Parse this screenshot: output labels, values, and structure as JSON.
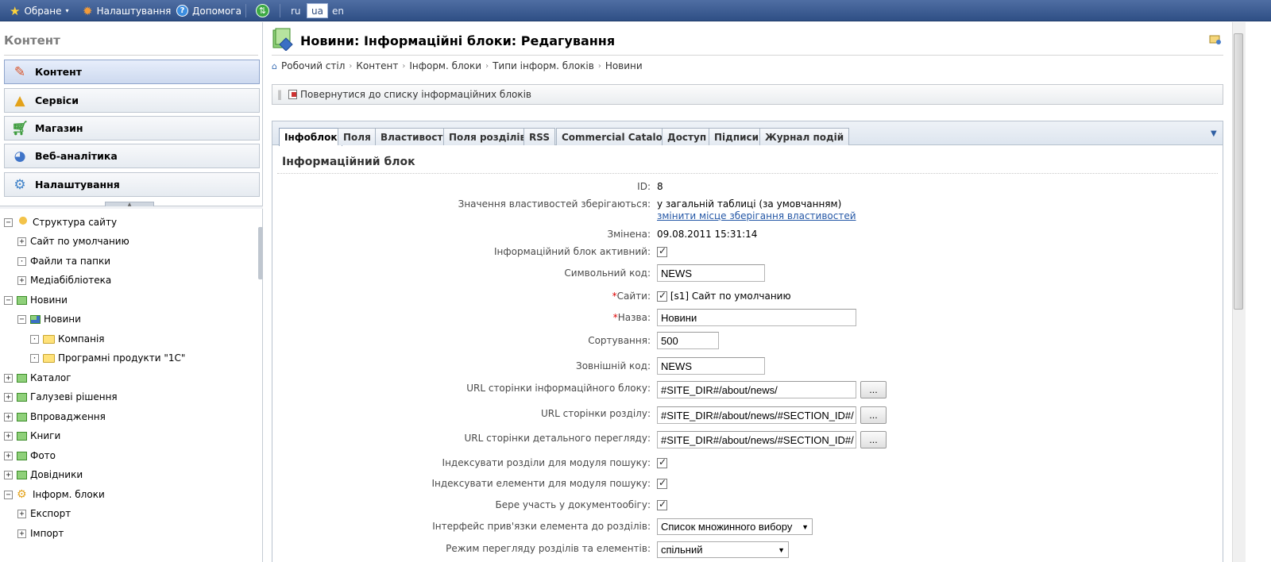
{
  "topbar": {
    "favorites": "Обране",
    "settings": "Налаштування",
    "help": "Допомога",
    "languages": [
      "ru",
      "ua",
      "en"
    ],
    "active_language": "ua"
  },
  "sidebar": {
    "title": "Контент",
    "menu": [
      {
        "label": "Контент",
        "icon": "pencil-icon",
        "active": true
      },
      {
        "label": "Сервіси",
        "icon": "shapes-icon",
        "active": false
      },
      {
        "label": "Магазин",
        "icon": "cart-icon",
        "active": false
      },
      {
        "label": "Веб-аналітика",
        "icon": "analytics-icon",
        "active": false
      },
      {
        "label": "Налаштування",
        "icon": "gear-icon",
        "active": false
      }
    ],
    "tree": [
      {
        "label": "Структура сайту",
        "toggle": "−"
      },
      {
        "label": "Сайт по умолчанию",
        "toggle": "+"
      },
      {
        "label": "Файли та папки",
        "toggle": "·"
      },
      {
        "label": "Медіабібліотека",
        "toggle": "+"
      },
      {
        "label": "Новини",
        "toggle": "−"
      },
      {
        "label": "Новини",
        "toggle": "−"
      },
      {
        "label": "Компанія",
        "toggle": "·"
      },
      {
        "label": "Програмні продукти \"1С\"",
        "toggle": "·"
      },
      {
        "label": "Каталог",
        "toggle": "+"
      },
      {
        "label": "Галузеві рішення",
        "toggle": "+"
      },
      {
        "label": "Впровадження",
        "toggle": "+"
      },
      {
        "label": "Книги",
        "toggle": "+"
      },
      {
        "label": "Фото",
        "toggle": "+"
      },
      {
        "label": "Довідники",
        "toggle": "+"
      },
      {
        "label": "Інформ. блоки",
        "toggle": "−"
      },
      {
        "label": "Експорт",
        "toggle": "+"
      },
      {
        "label": "Імпорт",
        "toggle": "+"
      }
    ]
  },
  "main": {
    "title": "Новини: Інформаційні блоки: Редагування",
    "breadcrumb": [
      "Робочий стіл",
      "Контент",
      "Інформ. блоки",
      "Типи інформ. блоків",
      "Новини"
    ],
    "back_link": "Повернутися до списку інформаційних блоків",
    "tabs": [
      "Інфоблок",
      "Поля",
      "Властивості",
      "Поля розділів",
      "RSS",
      "Commercial Catalog",
      "Доступ",
      "Підписи",
      "Журнал подій"
    ],
    "active_tab": "Інфоблок",
    "section_title": "Інформаційний блок",
    "form": {
      "id_label": "ID:",
      "id_value": "8",
      "storage_label": "Значення властивостей зберігаються:",
      "storage_value": "у загальній таблиці (за умовчанням)",
      "storage_link": "змінити місце зберігання властивостей",
      "changed_label": "Змінена:",
      "changed_value": "09.08.2011 15:31:14",
      "active_label": "Інформаційний блок активний:",
      "code_label": "Символьний код:",
      "code_value": "NEWS",
      "sites_label": "Сайти:",
      "sites_value": "[s1] Сайт по умолчанию",
      "name_label": "Назва:",
      "name_value": "Новини",
      "sort_label": "Сортування:",
      "sort_value": "500",
      "ext_code_label": "Зовнішній код:",
      "ext_code_value": "NEWS",
      "url_list_label": "URL сторінки інформаційного блоку:",
      "url_list_value": "#SITE_DIR#/about/news/",
      "url_section_label": "URL сторінки розділу:",
      "url_section_value": "#SITE_DIR#/about/news/#SECTION_ID#/",
      "url_detail_label": "URL сторінки детального перегляду:",
      "url_detail_value": "#SITE_DIR#/about/news/#SECTION_ID#/",
      "browse_label": "...",
      "index_sections_label": "Індексувати розділи для модуля пошуку:",
      "index_elements_label": "Індексувати елементи для модуля пошуку:",
      "workflow_label": "Бере участь у документообігу:",
      "binding_label": "Інтерфейс прив'язки елемента до розділів:",
      "binding_value": "Список множинного вибору",
      "view_mode_label": "Режим перегляду розділів та елементів:",
      "view_mode_value": "спільний"
    }
  }
}
